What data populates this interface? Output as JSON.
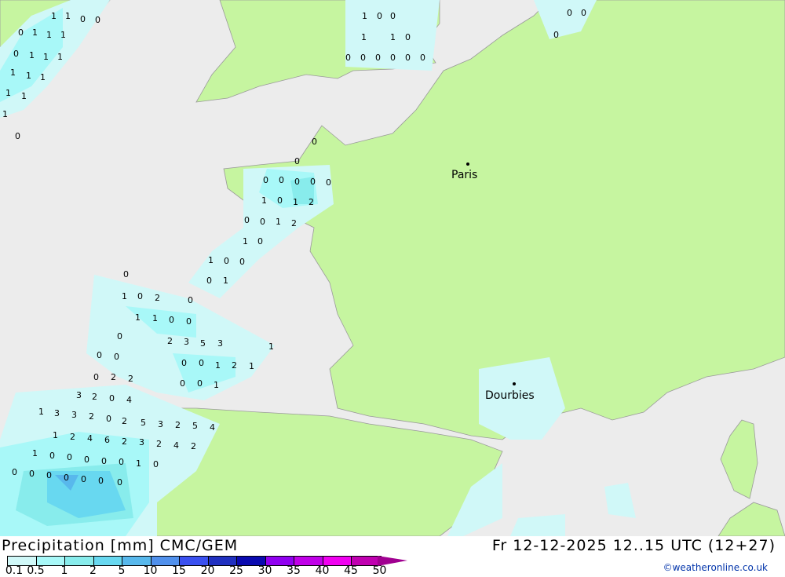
{
  "title": "Precipitation [mm] CMC/GEM",
  "datetime": "Fr 12-12-2025 12..15 UTC (12+27)",
  "credit": "©weatheronline.co.uk",
  "colors": {
    "land": "#c6f5a0",
    "sea": "#ececec",
    "border": "#9a9a9a"
  },
  "legend": {
    "colors": [
      "#d0f8f8",
      "#a8f8f8",
      "#88ecec",
      "#68d8f0",
      "#58b8ec",
      "#5090ec",
      "#3a50f0",
      "#2030c0",
      "#0a0ab0",
      "#9000f0",
      "#c000e8",
      "#f000f0",
      "#c000b0"
    ],
    "arrow_color": "#a00090",
    "ticks": [
      "0.1",
      "0.5",
      "1",
      "2",
      "5",
      "10",
      "15",
      "20",
      "25",
      "30",
      "35",
      "40",
      "45",
      "50"
    ]
  },
  "cities": [
    {
      "name": "Paris"
    },
    {
      "name": "Dourbies"
    }
  ],
  "map_values": [
    "1",
    "1",
    "0",
    "0",
    "0",
    "1",
    "1",
    "1",
    "0",
    "1",
    "1",
    "1",
    "1",
    "1",
    "1",
    "1",
    "1",
    "1",
    "1",
    "0",
    "0",
    "1",
    "1",
    "0",
    "0",
    "0",
    "0",
    "0",
    "0",
    "0",
    "0",
    "0",
    "0",
    "0",
    "0",
    "0",
    "0",
    "0",
    "0",
    "0",
    "0",
    "1",
    "0",
    "1",
    "2",
    "0",
    "0",
    "1",
    "2",
    "1",
    "0",
    "1",
    "0",
    "0",
    "0",
    "1",
    "0",
    "1",
    "0",
    "2",
    "0",
    "1",
    "1",
    "0",
    "0",
    "0",
    "2",
    "3",
    "5",
    "3",
    "1",
    "0",
    "0",
    "0",
    "0",
    "1",
    "2",
    "1",
    "0",
    "2",
    "2",
    "0",
    "0",
    "1",
    "3",
    "2",
    "0",
    "4",
    "1",
    "3",
    "3",
    "2",
    "0",
    "2",
    "5",
    "3",
    "2",
    "5",
    "4",
    "1",
    "2",
    "4",
    "6",
    "2",
    "3",
    "2",
    "4",
    "2",
    "1",
    "0",
    "0",
    "0",
    "0",
    "0",
    "1",
    "0",
    "0",
    "0",
    "0",
    "0",
    "0",
    "0",
    "0"
  ]
}
